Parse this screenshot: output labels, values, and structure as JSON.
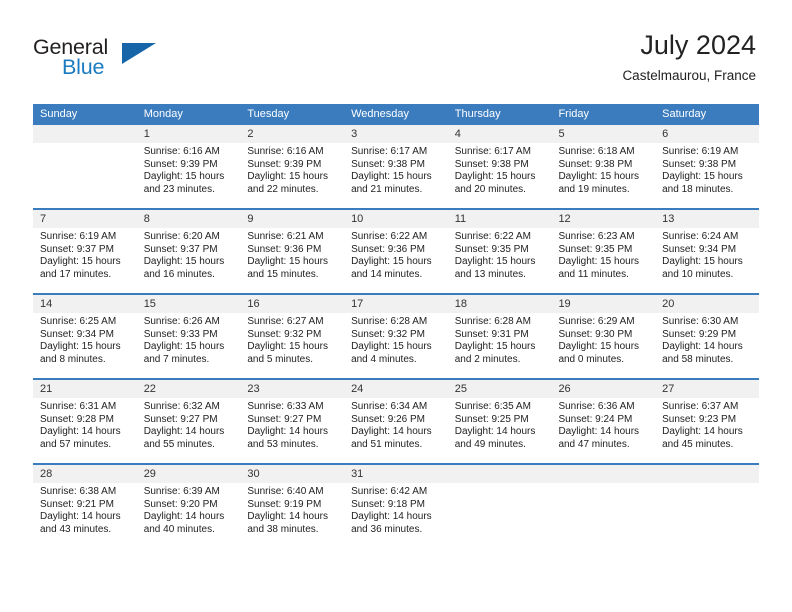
{
  "brand": {
    "name_part1": "General",
    "name_part2": "Blue",
    "triangle_icon": "triangle-icon",
    "color_dark": "#231f20",
    "color_blue": "#1a7bc0"
  },
  "header": {
    "title": "July 2024",
    "location": "Castelmaurou, France"
  },
  "theme": {
    "header_row_bg": "#3b7cbf",
    "daynum_bg": "#f1f1f1",
    "text": "#222222"
  },
  "calendar": {
    "weekdays": [
      "Sunday",
      "Monday",
      "Tuesday",
      "Wednesday",
      "Thursday",
      "Friday",
      "Saturday"
    ],
    "weeks": [
      [
        {
          "day": "",
          "sunrise": "",
          "sunset": "",
          "daylight1": "",
          "daylight2": ""
        },
        {
          "day": "1",
          "sunrise": "Sunrise: 6:16 AM",
          "sunset": "Sunset: 9:39 PM",
          "daylight1": "Daylight: 15 hours",
          "daylight2": "and 23 minutes."
        },
        {
          "day": "2",
          "sunrise": "Sunrise: 6:16 AM",
          "sunset": "Sunset: 9:39 PM",
          "daylight1": "Daylight: 15 hours",
          "daylight2": "and 22 minutes."
        },
        {
          "day": "3",
          "sunrise": "Sunrise: 6:17 AM",
          "sunset": "Sunset: 9:38 PM",
          "daylight1": "Daylight: 15 hours",
          "daylight2": "and 21 minutes."
        },
        {
          "day": "4",
          "sunrise": "Sunrise: 6:17 AM",
          "sunset": "Sunset: 9:38 PM",
          "daylight1": "Daylight: 15 hours",
          "daylight2": "and 20 minutes."
        },
        {
          "day": "5",
          "sunrise": "Sunrise: 6:18 AM",
          "sunset": "Sunset: 9:38 PM",
          "daylight1": "Daylight: 15 hours",
          "daylight2": "and 19 minutes."
        },
        {
          "day": "6",
          "sunrise": "Sunrise: 6:19 AM",
          "sunset": "Sunset: 9:38 PM",
          "daylight1": "Daylight: 15 hours",
          "daylight2": "and 18 minutes."
        }
      ],
      [
        {
          "day": "7",
          "sunrise": "Sunrise: 6:19 AM",
          "sunset": "Sunset: 9:37 PM",
          "daylight1": "Daylight: 15 hours",
          "daylight2": "and 17 minutes."
        },
        {
          "day": "8",
          "sunrise": "Sunrise: 6:20 AM",
          "sunset": "Sunset: 9:37 PM",
          "daylight1": "Daylight: 15 hours",
          "daylight2": "and 16 minutes."
        },
        {
          "day": "9",
          "sunrise": "Sunrise: 6:21 AM",
          "sunset": "Sunset: 9:36 PM",
          "daylight1": "Daylight: 15 hours",
          "daylight2": "and 15 minutes."
        },
        {
          "day": "10",
          "sunrise": "Sunrise: 6:22 AM",
          "sunset": "Sunset: 9:36 PM",
          "daylight1": "Daylight: 15 hours",
          "daylight2": "and 14 minutes."
        },
        {
          "day": "11",
          "sunrise": "Sunrise: 6:22 AM",
          "sunset": "Sunset: 9:35 PM",
          "daylight1": "Daylight: 15 hours",
          "daylight2": "and 13 minutes."
        },
        {
          "day": "12",
          "sunrise": "Sunrise: 6:23 AM",
          "sunset": "Sunset: 9:35 PM",
          "daylight1": "Daylight: 15 hours",
          "daylight2": "and 11 minutes."
        },
        {
          "day": "13",
          "sunrise": "Sunrise: 6:24 AM",
          "sunset": "Sunset: 9:34 PM",
          "daylight1": "Daylight: 15 hours",
          "daylight2": "and 10 minutes."
        }
      ],
      [
        {
          "day": "14",
          "sunrise": "Sunrise: 6:25 AM",
          "sunset": "Sunset: 9:34 PM",
          "daylight1": "Daylight: 15 hours",
          "daylight2": "and 8 minutes."
        },
        {
          "day": "15",
          "sunrise": "Sunrise: 6:26 AM",
          "sunset": "Sunset: 9:33 PM",
          "daylight1": "Daylight: 15 hours",
          "daylight2": "and 7 minutes."
        },
        {
          "day": "16",
          "sunrise": "Sunrise: 6:27 AM",
          "sunset": "Sunset: 9:32 PM",
          "daylight1": "Daylight: 15 hours",
          "daylight2": "and 5 minutes."
        },
        {
          "day": "17",
          "sunrise": "Sunrise: 6:28 AM",
          "sunset": "Sunset: 9:32 PM",
          "daylight1": "Daylight: 15 hours",
          "daylight2": "and 4 minutes."
        },
        {
          "day": "18",
          "sunrise": "Sunrise: 6:28 AM",
          "sunset": "Sunset: 9:31 PM",
          "daylight1": "Daylight: 15 hours",
          "daylight2": "and 2 minutes."
        },
        {
          "day": "19",
          "sunrise": "Sunrise: 6:29 AM",
          "sunset": "Sunset: 9:30 PM",
          "daylight1": "Daylight: 15 hours",
          "daylight2": "and 0 minutes."
        },
        {
          "day": "20",
          "sunrise": "Sunrise: 6:30 AM",
          "sunset": "Sunset: 9:29 PM",
          "daylight1": "Daylight: 14 hours",
          "daylight2": "and 58 minutes."
        }
      ],
      [
        {
          "day": "21",
          "sunrise": "Sunrise: 6:31 AM",
          "sunset": "Sunset: 9:28 PM",
          "daylight1": "Daylight: 14 hours",
          "daylight2": "and 57 minutes."
        },
        {
          "day": "22",
          "sunrise": "Sunrise: 6:32 AM",
          "sunset": "Sunset: 9:27 PM",
          "daylight1": "Daylight: 14 hours",
          "daylight2": "and 55 minutes."
        },
        {
          "day": "23",
          "sunrise": "Sunrise: 6:33 AM",
          "sunset": "Sunset: 9:27 PM",
          "daylight1": "Daylight: 14 hours",
          "daylight2": "and 53 minutes."
        },
        {
          "day": "24",
          "sunrise": "Sunrise: 6:34 AM",
          "sunset": "Sunset: 9:26 PM",
          "daylight1": "Daylight: 14 hours",
          "daylight2": "and 51 minutes."
        },
        {
          "day": "25",
          "sunrise": "Sunrise: 6:35 AM",
          "sunset": "Sunset: 9:25 PM",
          "daylight1": "Daylight: 14 hours",
          "daylight2": "and 49 minutes."
        },
        {
          "day": "26",
          "sunrise": "Sunrise: 6:36 AM",
          "sunset": "Sunset: 9:24 PM",
          "daylight1": "Daylight: 14 hours",
          "daylight2": "and 47 minutes."
        },
        {
          "day": "27",
          "sunrise": "Sunrise: 6:37 AM",
          "sunset": "Sunset: 9:23 PM",
          "daylight1": "Daylight: 14 hours",
          "daylight2": "and 45 minutes."
        }
      ],
      [
        {
          "day": "28",
          "sunrise": "Sunrise: 6:38 AM",
          "sunset": "Sunset: 9:21 PM",
          "daylight1": "Daylight: 14 hours",
          "daylight2": "and 43 minutes."
        },
        {
          "day": "29",
          "sunrise": "Sunrise: 6:39 AM",
          "sunset": "Sunset: 9:20 PM",
          "daylight1": "Daylight: 14 hours",
          "daylight2": "and 40 minutes."
        },
        {
          "day": "30",
          "sunrise": "Sunrise: 6:40 AM",
          "sunset": "Sunset: 9:19 PM",
          "daylight1": "Daylight: 14 hours",
          "daylight2": "and 38 minutes."
        },
        {
          "day": "31",
          "sunrise": "Sunrise: 6:42 AM",
          "sunset": "Sunset: 9:18 PM",
          "daylight1": "Daylight: 14 hours",
          "daylight2": "and 36 minutes."
        },
        {
          "day": "",
          "sunrise": "",
          "sunset": "",
          "daylight1": "",
          "daylight2": ""
        },
        {
          "day": "",
          "sunrise": "",
          "sunset": "",
          "daylight1": "",
          "daylight2": ""
        },
        {
          "day": "",
          "sunrise": "",
          "sunset": "",
          "daylight1": "",
          "daylight2": ""
        }
      ]
    ]
  }
}
